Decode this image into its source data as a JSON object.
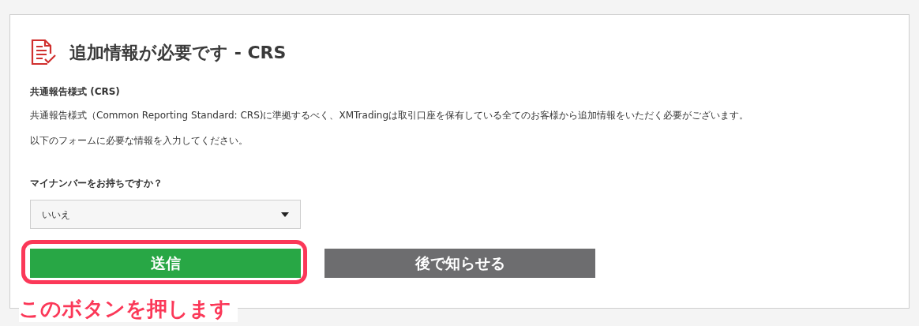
{
  "title": "追加情報が必要です - CRS",
  "section_title": "共通報告様式 (CRS)",
  "paragraphs": [
    "共通報告様式（Common Reporting Standard: CRS)に準拠するべく、XMTradingは取引口座を保有している全てのお客様から追加情報をいただく必要がございます。",
    "以下のフォームに必要な情報を入力してください。"
  ],
  "question": {
    "label": "マイナンバーをお持ちですか？",
    "value": "いいえ"
  },
  "buttons": [
    {
      "label": "送信",
      "kind": "primary",
      "highlighted": true
    },
    {
      "label": "後で知らせる",
      "kind": "secondary",
      "highlighted": false
    }
  ],
  "annotation": "このボタンを押します"
}
